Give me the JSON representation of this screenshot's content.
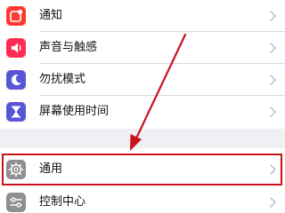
{
  "settings": {
    "group1": [
      {
        "label": "通知",
        "icon": "notifications-icon",
        "color": "#ff3b30"
      },
      {
        "label": "声音与触感",
        "icon": "sounds-haptics-icon",
        "color": "#ff2d55"
      },
      {
        "label": "勿扰模式",
        "icon": "do-not-disturb-moon-icon",
        "color": "#5856d6"
      },
      {
        "label": "屏幕使用时间",
        "icon": "screen-time-hourglass-icon",
        "color": "#5856d6"
      }
    ],
    "group2": [
      {
        "label": "通用",
        "icon": "general-gear-icon",
        "color": "#8e8e93"
      },
      {
        "label": "控制中心",
        "icon": "control-center-icon",
        "color": "#8e8e93"
      }
    ]
  },
  "annotation": {
    "highlight_color": "#c8141b",
    "arrow_color": "#c8141b"
  }
}
